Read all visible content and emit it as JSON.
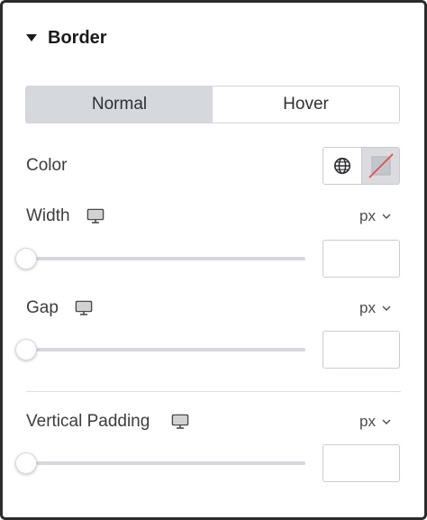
{
  "section": {
    "title": "Border",
    "caret_icon": "caret-down-icon"
  },
  "tabs": [
    {
      "label": "Normal",
      "active": true
    },
    {
      "label": "Hover",
      "active": false
    }
  ],
  "color": {
    "label": "Color",
    "global_icon": "globe-icon",
    "swatch_icon": "no-color-swatch-icon"
  },
  "controls": [
    {
      "label": "Width",
      "unit": "px",
      "value": "",
      "slider_value": 0,
      "device_icon": "desktop-icon"
    },
    {
      "label": "Gap",
      "unit": "px",
      "value": "",
      "slider_value": 0,
      "device_icon": "desktop-icon"
    },
    {
      "label": "Vertical Padding",
      "unit": "px",
      "value": "",
      "slider_value": 0,
      "device_icon": "desktop-icon"
    }
  ],
  "colors": {
    "tab_active_bg": "#d5d8dc",
    "track": "#d5d8dc",
    "swatch_slash": "#e2504c"
  }
}
